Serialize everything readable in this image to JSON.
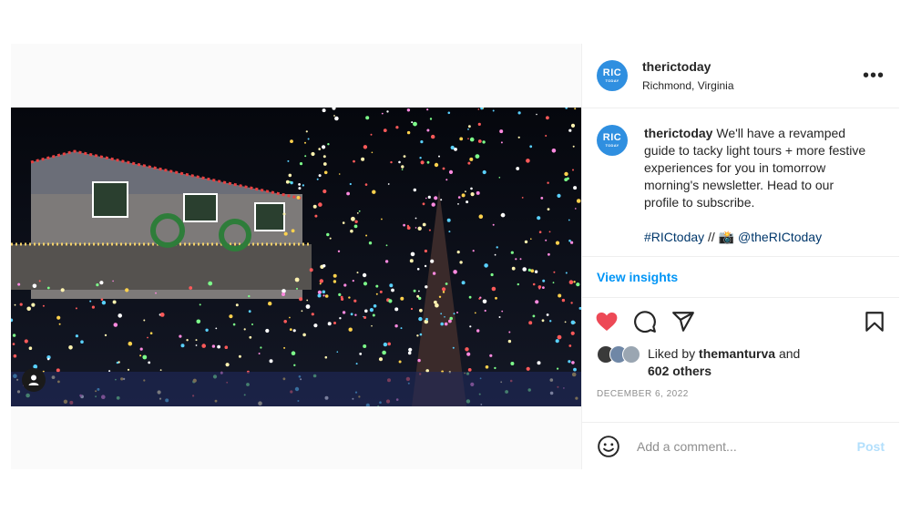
{
  "header": {
    "username": "therictoday",
    "location": "Richmond, Virginia",
    "avatar_line1": "RIC",
    "avatar_line2": "TODAY",
    "more_label": "•••"
  },
  "caption": {
    "username": "therictoday",
    "text": " We'll have a revamped guide to tacky light tours + more festive experiences for you in tomorrow morning's newsletter. Head to our profile to subscribe.",
    "hashtag": "#RICtoday",
    "separator": " // 📸 ",
    "mention": "@theRICtoday"
  },
  "insights_label": "View insights",
  "likes": {
    "prefix": "Liked by ",
    "user": "themanturva",
    "suffix": " and",
    "others": "602 others",
    "face_colors": [
      "#3a3a3a",
      "#6f87a6",
      "#9aa6b2"
    ]
  },
  "date": "DECEMBER 6, 2022",
  "comment": {
    "placeholder": "Add a comment...",
    "post_label": "Post"
  },
  "icons": {
    "like": "heart-icon",
    "comment": "comment-icon",
    "share": "paper-plane-icon",
    "save": "bookmark-icon",
    "emoji": "emoji-icon",
    "tag": "user-tag-icon"
  },
  "colors": {
    "accent": "#0095f6",
    "heart": "#ed4956",
    "avatar": "#2f8fe0",
    "link": "#00376b"
  }
}
